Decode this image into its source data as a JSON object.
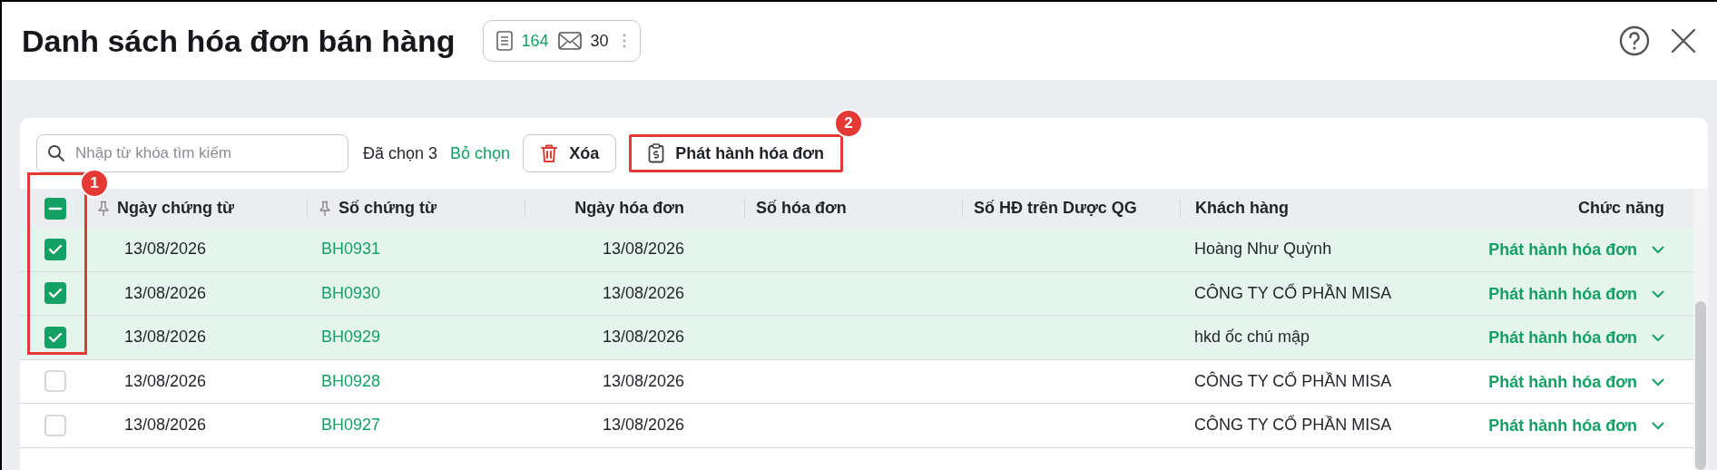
{
  "window": {
    "title": "Danh sách hóa đơn bán hàng"
  },
  "counters": [
    {
      "kind": "document",
      "value": "164"
    },
    {
      "kind": "mail",
      "value": "30"
    }
  ],
  "toolbar": {
    "search": {
      "placeholder": "Nhập từ khóa tìm kiếm"
    },
    "selected_count": "Đã chọn 3",
    "deselect": "Bỏ chọn",
    "delete_button": "Xóa",
    "issue_button": "Phát hành hóa đơn"
  },
  "table": {
    "select_all": {
      "indeterminate": true
    },
    "columns": [
      {
        "label": "Ngày chứng từ",
        "pinned": true
      },
      {
        "label": "Số chứng từ",
        "pinned": true
      },
      {
        "label": "Ngày hóa đơn",
        "pinned": false
      },
      {
        "label": "Số hóa đơn",
        "pinned": false
      },
      {
        "label": "Số HĐ trên Dược QG",
        "pinned": false
      },
      {
        "label": "Khách hàng",
        "pinned": false
      },
      {
        "label": "Chức năng",
        "pinned": false
      }
    ],
    "rows": [
      {
        "selected": true,
        "doc_date": "13/08/2026",
        "doc_no": "BH0931",
        "invoice_date": "13/08/2026",
        "customer": "Hoàng Như Quỳnh",
        "action": "Phát hành hóa đơn"
      },
      {
        "selected": true,
        "doc_date": "13/08/2026",
        "doc_no": "BH0930",
        "invoice_date": "13/08/2026",
        "customer": "CÔNG TY CỔ PHẦN MISA",
        "action": "Phát hành hóa đơn"
      },
      {
        "selected": true,
        "doc_date": "13/08/2026",
        "doc_no": "BH0929",
        "invoice_date": "13/08/2026",
        "customer": "hkd ốc chú mập",
        "action": "Phát hành hóa đơn"
      },
      {
        "selected": false,
        "doc_date": "13/08/2026",
        "doc_no": "BH0928",
        "invoice_date": "13/08/2026",
        "customer": "CÔNG TY CỔ PHẦN MISA",
        "action": "Phát hành hóa đơn"
      },
      {
        "selected": false,
        "doc_date": "13/08/2026",
        "doc_no": "BH0927",
        "invoice_date": "13/08/2026",
        "customer": "CÔNG TY CỔ PHẦN MISA",
        "action": "Phát hành hóa đơn"
      }
    ]
  },
  "annotations": [
    {
      "label": "1"
    },
    {
      "label": "2"
    }
  ]
}
